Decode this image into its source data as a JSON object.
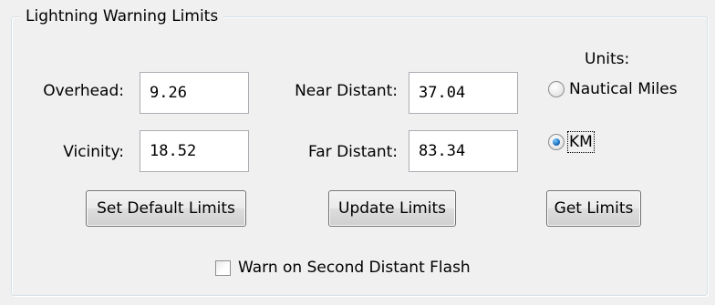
{
  "group": {
    "title": "Lightning Warning Limits"
  },
  "fields": {
    "overhead": {
      "label": "Overhead:",
      "value": "9.26"
    },
    "vicinity": {
      "label": "Vicinity:",
      "value": "18.52"
    },
    "near_distant": {
      "label": "Near Distant:",
      "value": "37.04"
    },
    "far_distant": {
      "label": "Far Distant:",
      "value": "83.34"
    }
  },
  "units": {
    "label": "Units:",
    "options": [
      {
        "label": "Nautical Miles",
        "checked": false
      },
      {
        "label": "KM",
        "checked": true
      }
    ]
  },
  "buttons": {
    "set_default": "Set Default Limits",
    "update": "Update Limits",
    "get": "Get Limits"
  },
  "checkbox": {
    "label": "Warn on Second Distant Flash",
    "checked": false
  }
}
